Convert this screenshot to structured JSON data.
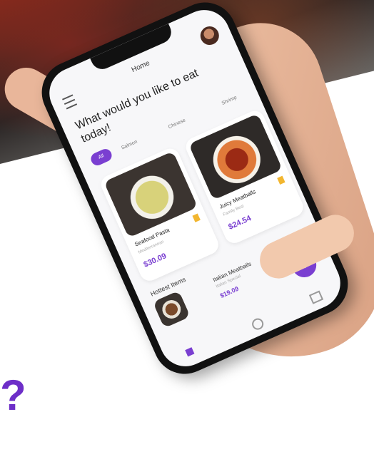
{
  "header": {
    "home_title": "Home"
  },
  "headline": "What would you like to eat today!",
  "categories": {
    "active": "All",
    "items": [
      "Salmon",
      "Chinese",
      "Shrimp"
    ]
  },
  "cards": [
    {
      "name": "Seafood Pasta",
      "sub": "Mediterranean",
      "price": "$30.09"
    },
    {
      "name": "Juicy Meatballs",
      "sub": "Family Best",
      "price": "$24.54"
    }
  ],
  "hottest": {
    "title": "Hottest Items",
    "item": {
      "name": "Italian Meatballs",
      "sub": "Italian Special",
      "price": "$19.09"
    }
  },
  "fab": {
    "label": "+"
  },
  "brand_glyph": "?",
  "colors": {
    "accent": "#7a3fd1",
    "bookmark": "#f2b630"
  }
}
